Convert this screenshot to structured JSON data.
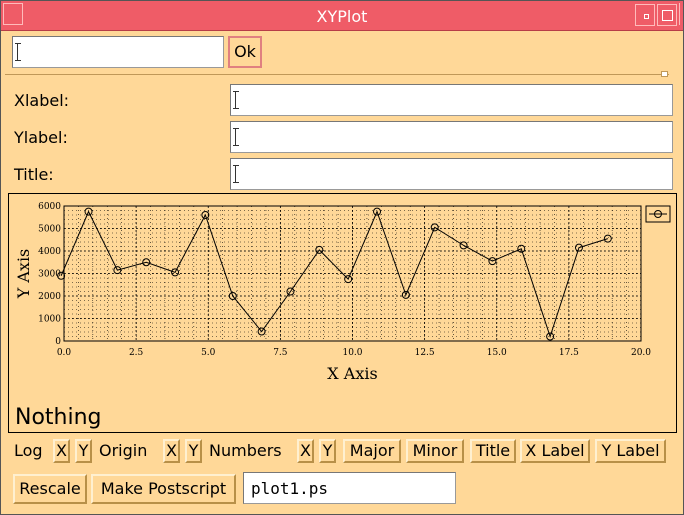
{
  "window": {
    "title": "XYPlot"
  },
  "top": {
    "input_value": "",
    "ok_label": "Ok"
  },
  "labels": {
    "xlabel": "Xlabel:",
    "ylabel": "Ylabel:",
    "title": "Title:"
  },
  "fields": {
    "xlabel_value": "",
    "ylabel_value": "",
    "title_value": ""
  },
  "status": "Nothing",
  "chart_data": {
    "type": "line",
    "xlabel": "X Axis",
    "ylabel": "Y Axis",
    "xlim": [
      0,
      20
    ],
    "ylim": [
      0,
      6000
    ],
    "xticks": [
      "0.0",
      "2.5",
      "5.0",
      "7.5",
      "10.0",
      "12.5",
      "15.0",
      "17.5",
      "20.0"
    ],
    "yticks": [
      "0",
      "1000",
      "2000",
      "3000",
      "4000",
      "5000",
      "6000"
    ],
    "grid": true,
    "series": [
      {
        "x": [
          -0.1,
          0.85,
          1.85,
          2.85,
          3.85,
          4.9,
          5.85,
          6.85,
          7.85,
          8.85,
          9.85,
          10.85,
          11.85,
          12.85,
          13.85,
          14.85,
          15.85,
          16.85,
          17.85,
          18.85
        ],
        "values": [
          2900,
          5750,
          3150,
          3500,
          3050,
          5600,
          2000,
          420,
          2200,
          4050,
          2750,
          5750,
          2050,
          5050,
          4250,
          3550,
          4100,
          200,
          4150,
          4550
        ]
      }
    ],
    "legend": "top-right"
  },
  "toolbar": {
    "log": "Log",
    "log_x": "X",
    "log_y": "Y",
    "origin": "Origin",
    "origin_x": "X",
    "origin_y": "Y",
    "numbers": "Numbers",
    "numbers_x": "X",
    "numbers_y": "Y",
    "major": "Major",
    "minor": "Minor",
    "title": "Title",
    "x_label": "X Label",
    "y_label": "Y Label"
  },
  "bottom": {
    "rescale": "Rescale",
    "postscript": "Make Postscript",
    "filename": "plot1.ps"
  }
}
